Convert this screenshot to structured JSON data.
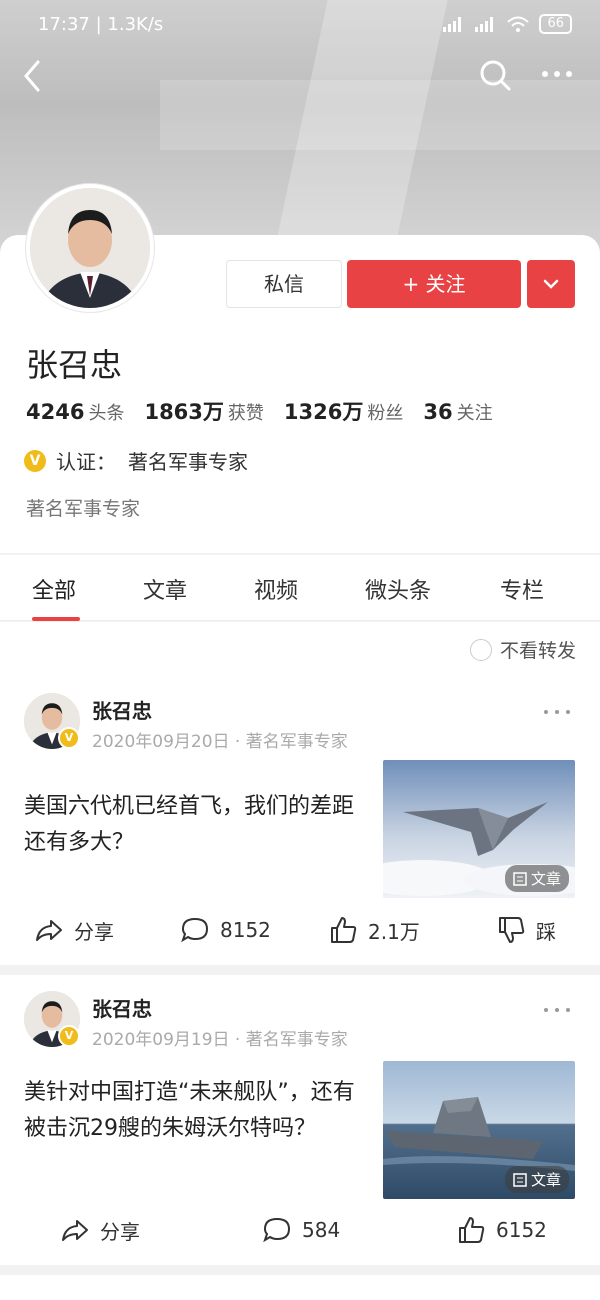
{
  "status_bar": {
    "time": "17:37",
    "speed": "1.3K/s",
    "battery": "66"
  },
  "profile": {
    "name": "张召忠",
    "message_label": "私信",
    "follow_label": "+ 关注",
    "stats": [
      {
        "value": "4246",
        "label": "头条"
      },
      {
        "value": "1863万",
        "label": "获赞"
      },
      {
        "value": "1326万",
        "label": "粉丝"
      },
      {
        "value": "36",
        "label": "关注"
      }
    ],
    "verify_label": "认证：",
    "verify_value": "著名军事专家",
    "bio": "著名军事专家"
  },
  "tabs": [
    "全部",
    "文章",
    "视频",
    "微头条",
    "专栏"
  ],
  "filter_label": "不看转发",
  "posts": [
    {
      "author": "张召忠",
      "meta": "2020年09月20日 · 著名军事专家",
      "title": "美国六代机已经首飞，我们的差距还有多大？",
      "tag": "文章",
      "share": "分享",
      "comments": "8152",
      "likes": "2.1万",
      "dislike": "踩"
    },
    {
      "author": "张召忠",
      "meta": "2020年09月19日 · 著名军事专家",
      "title": "美针对中国打造“未来舰队”，还有被击沉29艘的朱姆沃尔特吗？",
      "tag": "文章",
      "share": "分享",
      "comments": "584",
      "likes": "6152"
    }
  ]
}
